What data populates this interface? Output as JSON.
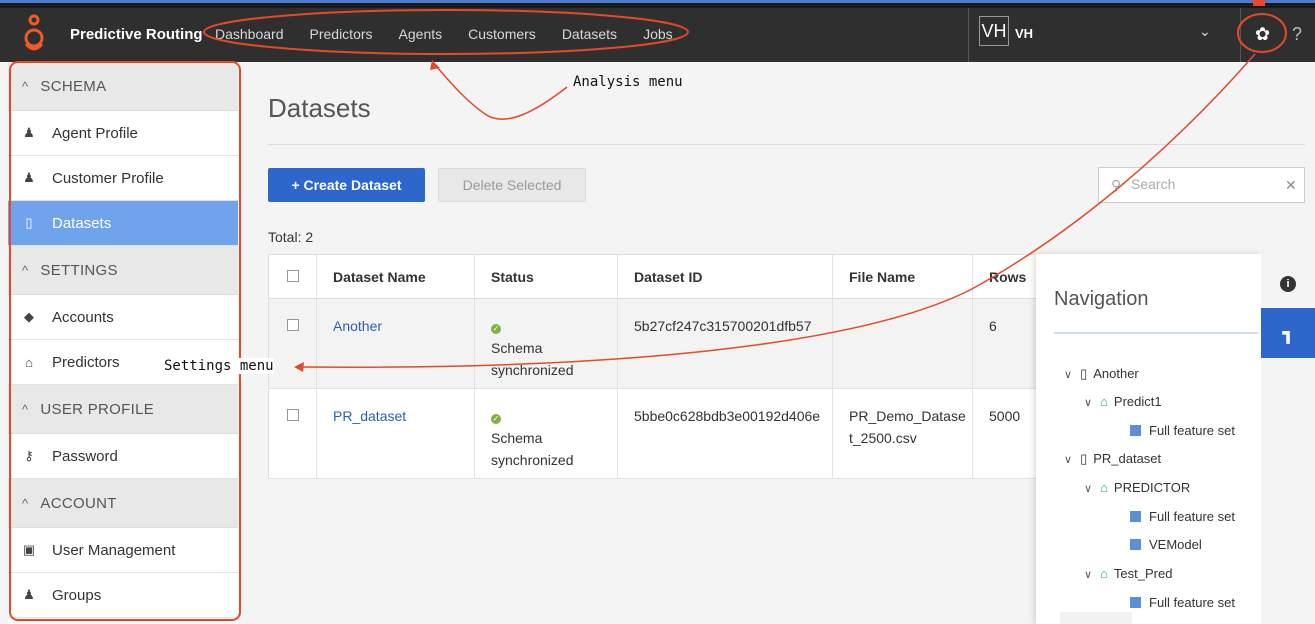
{
  "topbar": {
    "brand": "Predictive Routing",
    "nav": [
      "Dashboard",
      "Predictors",
      "Agents",
      "Customers",
      "Datasets",
      "Jobs"
    ],
    "avatar": "VH",
    "user": "VH",
    "icons": [
      "genesys-logo-icon",
      "chevron-down-icon",
      "gear-icon",
      "help-icon"
    ]
  },
  "sidebar": {
    "sections": [
      {
        "title": "SCHEMA",
        "items": [
          {
            "label": "Agent Profile",
            "icon": "agent-icon"
          },
          {
            "label": "Customer Profile",
            "icon": "customers-icon"
          },
          {
            "label": "Datasets",
            "icon": "document-icon",
            "active": true
          }
        ]
      },
      {
        "title": "SETTINGS",
        "items": [
          {
            "label": "Accounts",
            "icon": "cube-icon"
          },
          {
            "label": "Predictors",
            "icon": "graduation-cap-icon"
          }
        ]
      },
      {
        "title": "USER PROFILE",
        "items": [
          {
            "label": "Password",
            "icon": "key-icon"
          }
        ]
      },
      {
        "title": "ACCOUNT",
        "items": [
          {
            "label": "User Management",
            "icon": "id-card-icon"
          },
          {
            "label": "Groups",
            "icon": "group-icon"
          }
        ]
      }
    ]
  },
  "main": {
    "title": "Datasets",
    "create_label": "+ Create Dataset",
    "delete_label": "Delete Selected",
    "search_placeholder": "Search",
    "total": "Total: 2",
    "columns": [
      "Dataset Name",
      "Status",
      "Dataset ID",
      "File Name",
      "Rows"
    ],
    "rows": [
      {
        "name": "Another",
        "status": "Schema synchronized",
        "id": "5b27cf247c315700201dfb57",
        "file": "",
        "rows": "6"
      },
      {
        "name": "PR_dataset",
        "status": "Schema synchronized",
        "id": "5bbe0c628bdb3e00192d406e",
        "file": "PR_Demo_Datase t_2500.csv",
        "rows": "5000"
      }
    ]
  },
  "navigation": {
    "title": "Navigation",
    "tree": [
      {
        "label": "Another",
        "level": 0,
        "icon": "document-icon"
      },
      {
        "label": "Predict1",
        "level": 1,
        "icon": "graduation-cap-icon"
      },
      {
        "label": "Full feature set",
        "level": 2,
        "icon": "calculator-icon"
      },
      {
        "label": "PR_dataset",
        "level": 0,
        "icon": "document-icon"
      },
      {
        "label": "PREDICTOR",
        "level": 1,
        "icon": "graduation-cap-icon"
      },
      {
        "label": "Full feature set",
        "level": 2,
        "icon": "calculator-icon"
      },
      {
        "label": "VEModel",
        "level": 2,
        "icon": "calculator-icon"
      },
      {
        "label": "Test_Pred",
        "level": 1,
        "icon": "graduation-cap-icon"
      },
      {
        "label": "Full feature set",
        "level": 2,
        "icon": "calculator-icon"
      }
    ]
  },
  "annotations": {
    "analysis": "Analysis menu",
    "settings": "Settings menu"
  },
  "colors": {
    "primary": "#2d67cc",
    "sidebar_active": "#6fa3ec",
    "annotation": "#e24a2a",
    "topbar": "#2f2f2f"
  }
}
